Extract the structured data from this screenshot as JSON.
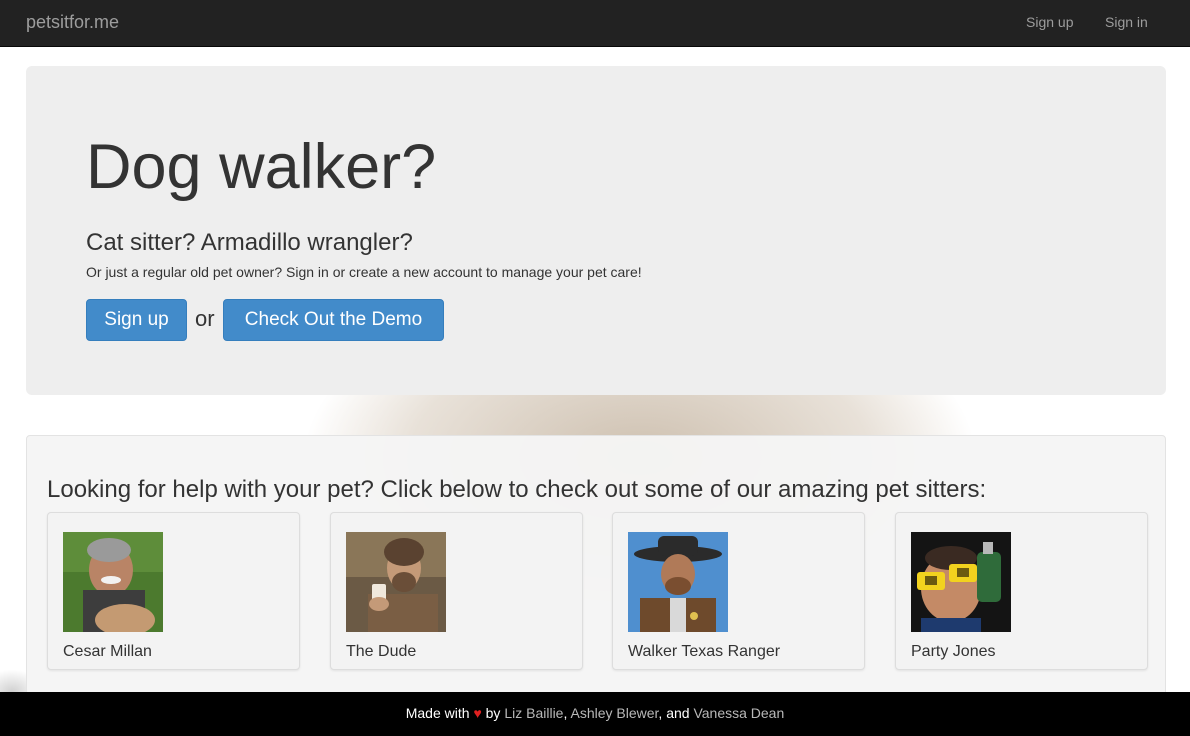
{
  "navbar": {
    "brand": "petsitfor.me",
    "links": [
      {
        "label": "Sign up"
      },
      {
        "label": "Sign in"
      }
    ]
  },
  "hero": {
    "title": "Dog walker?",
    "subtitle": "Cat sitter? Armadillo wrangler?",
    "text": "Or just a regular old pet owner? Sign in or create a new account to manage your pet care!",
    "signup_button": "Sign up",
    "or_text": "or",
    "demo_button": "Check Out the Demo"
  },
  "sitters": {
    "heading": "Looking for help with your pet? Click below to check out some of our amazing pet sitters:",
    "cards": [
      {
        "name": "Cesar Millan"
      },
      {
        "name": "The Dude"
      },
      {
        "name": "Walker Texas Ranger"
      },
      {
        "name": "Party Jones"
      }
    ]
  },
  "footer": {
    "made_with": "Made with",
    "heart": "♥",
    "by": "by",
    "authors": [
      "Liz Baillie",
      "Ashley Blewer",
      "Vanessa Dean"
    ],
    "comma": ",",
    "and": "and"
  },
  "colors": {
    "navbar_bg": "#222222",
    "primary_button": "#428bca",
    "jumbotron_bg": "#eeeeee",
    "footer_bg": "#000000",
    "heart": "#e02020"
  }
}
